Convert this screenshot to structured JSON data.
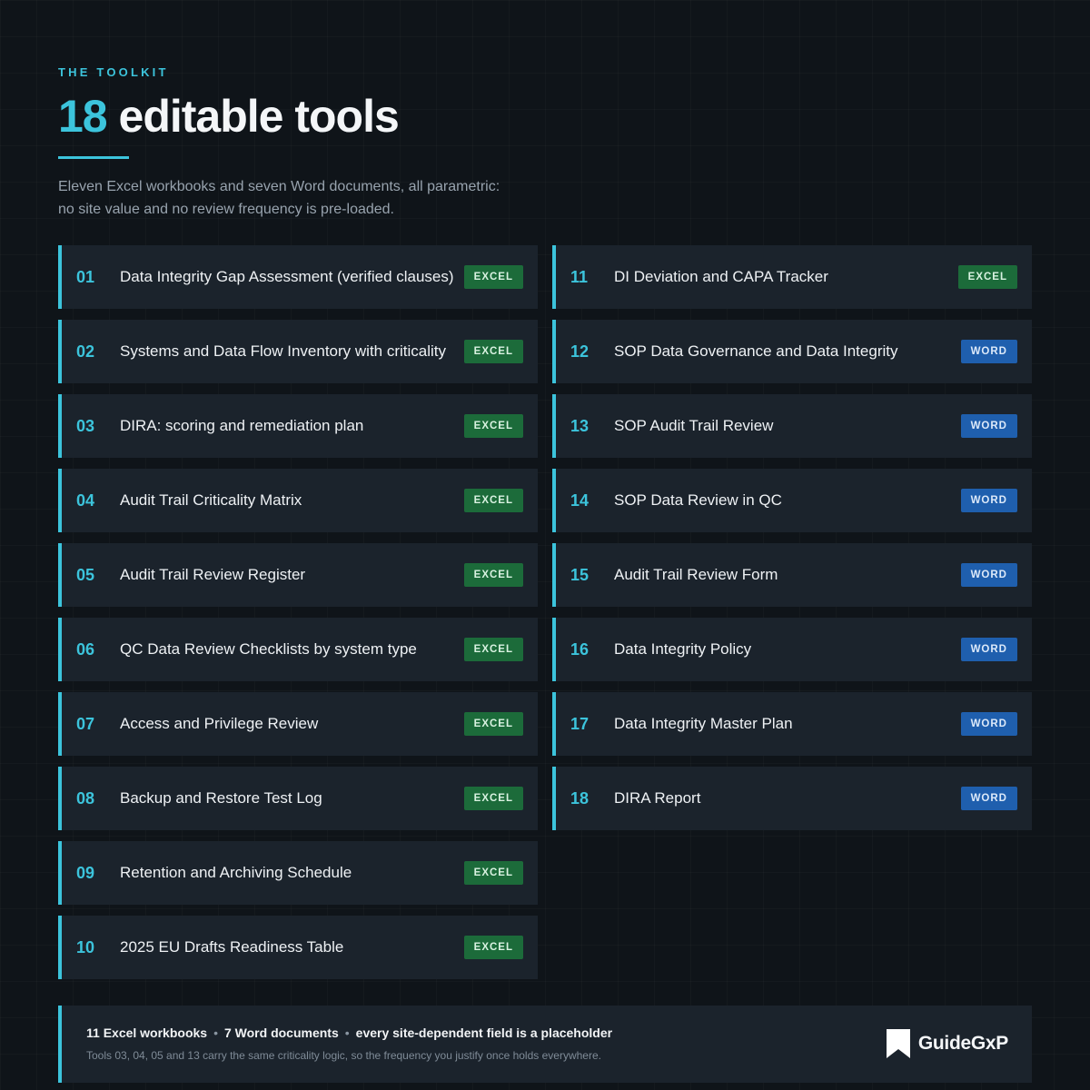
{
  "header": {
    "eyebrow": "THE TOOLKIT",
    "title_number": "18",
    "title_text": "editable tools",
    "subtitle_line1": "Eleven Excel workbooks and seven Word documents, all parametric:",
    "subtitle_line2": "no site value and no review frequency is pre-loaded."
  },
  "tools": [
    {
      "num": "01",
      "name": "Data Integrity Gap Assessment (verified clauses)",
      "type": "EXCEL"
    },
    {
      "num": "02",
      "name": "Systems and Data Flow Inventory with criticality",
      "type": "EXCEL"
    },
    {
      "num": "03",
      "name": "DIRA: scoring and remediation plan",
      "type": "EXCEL"
    },
    {
      "num": "04",
      "name": "Audit Trail Criticality Matrix",
      "type": "EXCEL"
    },
    {
      "num": "05",
      "name": "Audit Trail Review Register",
      "type": "EXCEL"
    },
    {
      "num": "06",
      "name": "QC Data Review Checklists by system type",
      "type": "EXCEL"
    },
    {
      "num": "07",
      "name": "Access and Privilege Review",
      "type": "EXCEL"
    },
    {
      "num": "08",
      "name": "Backup and Restore Test Log",
      "type": "EXCEL"
    },
    {
      "num": "09",
      "name": "Retention and Archiving Schedule",
      "type": "EXCEL"
    },
    {
      "num": "10",
      "name": "2025 EU Drafts Readiness Table",
      "type": "EXCEL"
    },
    {
      "num": "11",
      "name": "DI Deviation and CAPA Tracker",
      "type": "EXCEL"
    },
    {
      "num": "12",
      "name": "SOP Data Governance and Data Integrity",
      "type": "WORD"
    },
    {
      "num": "13",
      "name": "SOP Audit Trail Review",
      "type": "WORD"
    },
    {
      "num": "14",
      "name": "SOP Data Review in QC",
      "type": "WORD"
    },
    {
      "num": "15",
      "name": "Audit Trail Review Form",
      "type": "WORD"
    },
    {
      "num": "16",
      "name": "Data Integrity Policy",
      "type": "WORD"
    },
    {
      "num": "17",
      "name": "Data Integrity Master Plan",
      "type": "WORD"
    },
    {
      "num": "18",
      "name": "DIRA Report",
      "type": "WORD"
    }
  ],
  "footer": {
    "item1": "11 Excel workbooks",
    "item2": "7 Word documents",
    "item3": "every site-dependent field is a placeholder",
    "separator": "•",
    "note": "Tools 03, 04, 05 and 13 carry the same criticality logic, so the frequency you justify once holds everywhere.",
    "brand": "GuideGxP"
  },
  "colors": {
    "accent": "#3cc4dc",
    "excel_badge": "#1c6b3a",
    "word_badge": "#1f5fae",
    "card": "#1b232c",
    "background": "#0f1419"
  }
}
